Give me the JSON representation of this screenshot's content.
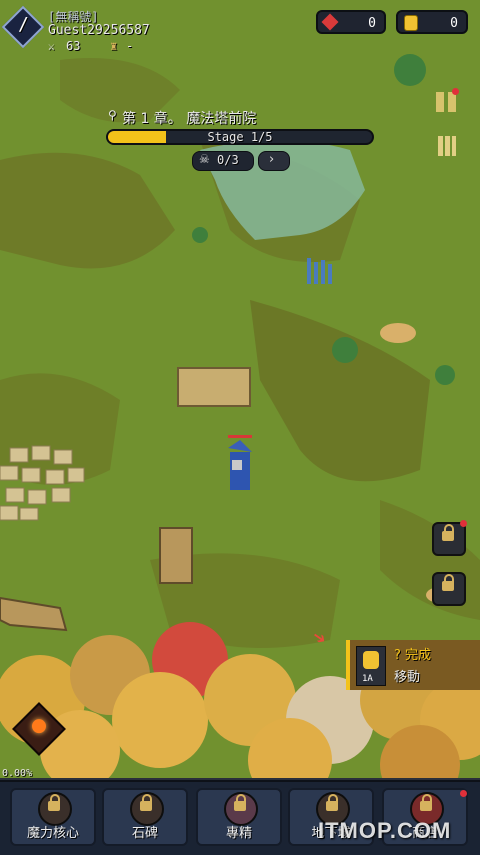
{
  "player": {
    "title": "[無稱號]",
    "name": "Guest29256587",
    "power": "63",
    "trophy": "-",
    "level_badge": "/"
  },
  "currency": {
    "gems": "0",
    "gold": "0"
  },
  "stage": {
    "chapter": "第 1 章。 魔法塔前院",
    "stage_label": "Stage 1/5",
    "progress": 0.22,
    "kills": "0/3"
  },
  "quest": {
    "status": "? 完成",
    "task": "移動",
    "reward_count": "1A"
  },
  "progress_text": "0.00%",
  "nav": {
    "items": [
      {
        "label": "魔力核心"
      },
      {
        "label": "石碑"
      },
      {
        "label": "專精"
      },
      {
        "label": "地下城"
      },
      {
        "label": "商店"
      }
    ]
  },
  "watermark": "ITMOP.COM",
  "icons": {
    "gem": "red-gem-icon",
    "gold": "gold-coin-icon",
    "skull": "skull-icon",
    "location": "location-pin-icon",
    "lock": "lock-icon",
    "fire_skill": "fire-skill-icon"
  }
}
